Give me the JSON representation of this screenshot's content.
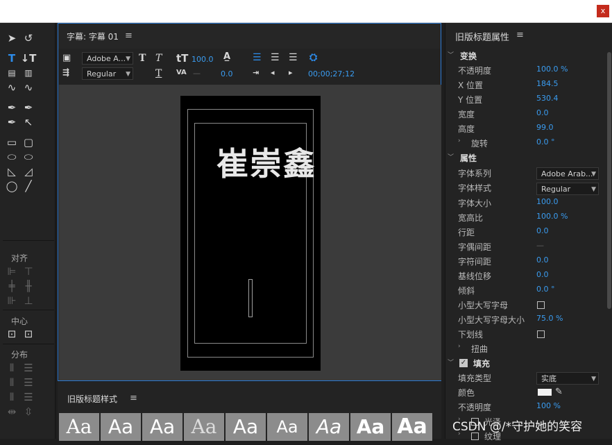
{
  "window": {
    "close_label": "x"
  },
  "tools_panel": {
    "align_label": "对齐",
    "center_label": "中心",
    "distribute_label": "分布"
  },
  "title_panel": {
    "tab_title": "字幕: 字幕 01",
    "menu_icon": "≡",
    "font_family": "Adobe A...",
    "font_style": "Regular",
    "font_size": "100.0",
    "kerning": "—",
    "tracking": "0.0",
    "timecode": "00;00;27;12",
    "canvas_text": "崔崇鑫"
  },
  "styles_panel": {
    "title": "旧版标题样式",
    "menu_icon": "≡",
    "tiles": [
      "Aa",
      "Aa",
      "Aa",
      "Aa",
      "Aa",
      "Aa",
      "Aa",
      "Aa",
      "Aa"
    ]
  },
  "props_panel": {
    "title": "旧版标题属性",
    "menu_icon": "≡",
    "transform_section": "变换",
    "opacity_label": "不透明度",
    "opacity_value": "100.0 %",
    "xpos_label": "X 位置",
    "xpos_value": "184.5",
    "ypos_label": "Y 位置",
    "ypos_value": "530.4",
    "width_label": "宽度",
    "width_value": "0.0",
    "height_label": "高度",
    "height_value": "99.0",
    "rotation_label": "旋转",
    "rotation_value": "0.0 °",
    "properties_section": "属性",
    "font_family_label": "字体系列",
    "font_family_value": "Adobe Arab...",
    "font_style_label": "字体样式",
    "font_style_value": "Regular",
    "font_size_label": "字体大小",
    "font_size_value": "100.0",
    "aspect_label": "宽高比",
    "aspect_value": "100.0 %",
    "leading_label": "行距",
    "leading_value": "0.0",
    "kerning_label": "字偶间距",
    "kerning_value": "—",
    "tracking_label": "字符间距",
    "tracking_value": "0.0",
    "baseline_label": "基线位移",
    "baseline_value": "0.0",
    "slant_label": "倾斜",
    "slant_value": "0.0 °",
    "smallcaps_label": "小型大写字母",
    "smallcaps_size_label": "小型大写字母大小",
    "smallcaps_size_value": "75.0 %",
    "underline_label": "下划线",
    "distort_label": "扭曲",
    "fill_section": "填充",
    "fill_type_label": "填充类型",
    "fill_type_value": "实底",
    "color_label": "颜色",
    "fill_opacity_label": "不透明度",
    "fill_opacity_value": "100 %",
    "sheen_label": "光泽",
    "texture_label": "纹理"
  },
  "watermark": "CSDN @/*守护她的笑容",
  "colors": {
    "accent": "#2d8ceb",
    "value_blue": "#3a9cf0",
    "panel_bg": "#232323",
    "canvas_bg": "#3b3b3b"
  }
}
